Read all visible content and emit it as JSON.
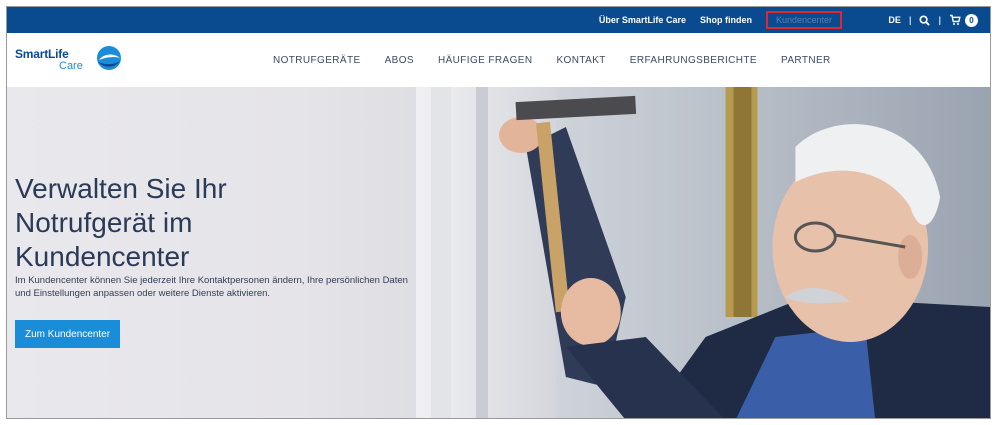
{
  "topbar": {
    "links": [
      {
        "label": "Über SmartLife Care"
      },
      {
        "label": "Shop finden"
      },
      {
        "label": "Kundencenter"
      }
    ],
    "language": "DE",
    "cart_count": "0"
  },
  "nav": {
    "logo_line1": "SmartLife",
    "logo_line2": "Care",
    "items": [
      {
        "label": "NOTRUFGERÄTE"
      },
      {
        "label": "ABOS"
      },
      {
        "label": "HÄUFIGE FRAGEN"
      },
      {
        "label": "KONTAKT"
      },
      {
        "label": "ERFAHRUNGSBERICHTE"
      },
      {
        "label": "PARTNER"
      }
    ]
  },
  "hero": {
    "headline_lines": [
      "Verwalten Sie Ihr",
      "Notrufgerät im",
      "Kundencenter"
    ],
    "description": "Im Kundencenter können Sie jederzeit Ihre Kontaktpersonen ändern, Ihre persönlichen Daten und Einstellungen anpassen oder weitere Dienste aktivieren.",
    "cta_label": "Zum Kundencenter"
  },
  "colors": {
    "brand_blue": "#0a4a8f",
    "accent_blue": "#1a8dd8",
    "highlight_red": "#e0262f"
  },
  "icons": [
    "search-icon",
    "cart-icon",
    "smartlife-logo-mark"
  ]
}
